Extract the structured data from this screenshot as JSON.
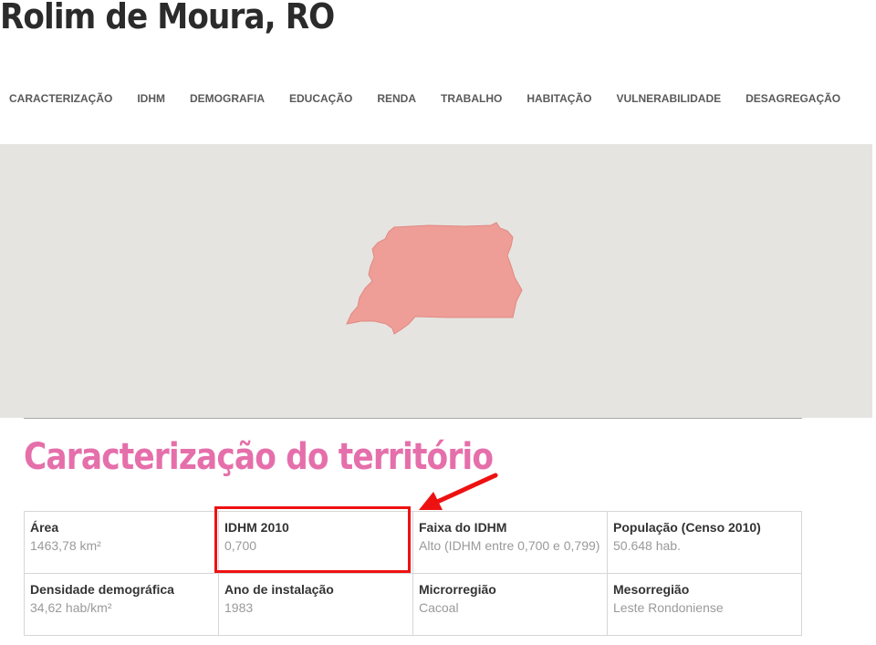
{
  "header": {
    "city_title": "Rolim de Moura, RO"
  },
  "nav": {
    "items": [
      "CARACTERIZAÇÃO",
      "IDHM",
      "DEMOGRAFIA",
      "EDUCAÇÃO",
      "RENDA",
      "TRABALHO",
      "HABITAÇÃO",
      "VULNERABILIDADE",
      "DESAGREGAÇÃO"
    ]
  },
  "colors": {
    "section_title": "#e56fab",
    "map_background": "#e6e4e0",
    "map_shape": "#ee9d97",
    "annotation": "#ee1111"
  },
  "section": {
    "title": "Caracterização do território",
    "cells": [
      {
        "label": "Área",
        "value": "1463,78 km²"
      },
      {
        "label": "IDHM 2010",
        "value": "0,700"
      },
      {
        "label": "Faixa do IDHM",
        "value": "Alto (IDHM entre 0,700 e 0,799)"
      },
      {
        "label": "População (Censo 2010)",
        "value": "50.648 hab."
      },
      {
        "label": "Densidade demográfica",
        "value": "34,62 hab/km²"
      },
      {
        "label": "Ano de instalação",
        "value": "1983"
      },
      {
        "label": "Microrregião",
        "value": "Cacoal"
      },
      {
        "label": "Mesorregião",
        "value": "Leste Rondoniense"
      }
    ]
  }
}
